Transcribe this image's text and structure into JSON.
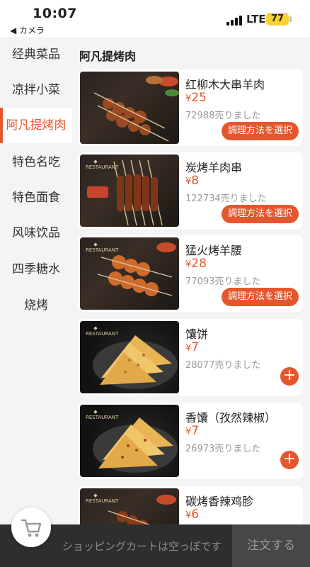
{
  "status_bar": {
    "time": "10:07",
    "back_label": "◀ カメラ",
    "network": "LTE",
    "battery": "77"
  },
  "sidebar": {
    "items": [
      {
        "label": "经典菜品",
        "active": false
      },
      {
        "label": "凉拌小菜",
        "active": false
      },
      {
        "label": "阿凡提烤肉",
        "active": true
      },
      {
        "label": "特色名吃",
        "active": false
      },
      {
        "label": "特色面食",
        "active": false
      },
      {
        "label": "风味饮品",
        "active": false
      },
      {
        "label": "四季糖水",
        "active": false
      },
      {
        "label": "烧烤",
        "active": false
      }
    ]
  },
  "main": {
    "category_title": "阿凡提烤肉",
    "currency": "¥",
    "products": [
      {
        "name": "红柳木大串羊肉",
        "price": "25",
        "sold": "72988売りました",
        "action": "調理方法を選択",
        "image": "skewer"
      },
      {
        "name": "炭烤羊肉串",
        "price": "8",
        "sold": "122734売りました",
        "action": "調理方法を選択",
        "image": "skewer"
      },
      {
        "name": "猛火烤羊腰",
        "price": "28",
        "sold": "77093売りました",
        "action": "調理方法を選択",
        "image": "skewer"
      },
      {
        "name": "馕饼",
        "price": "7",
        "sold": "28077売りました",
        "action": "+",
        "image": "bread"
      },
      {
        "name": "香馕（孜然辣椒）",
        "price": "7",
        "sold": "26973売りました",
        "action": "+",
        "image": "bread"
      },
      {
        "name": "碳烤香辣鸡胗",
        "price": "6",
        "sold": "",
        "action": "",
        "image": "skewer"
      }
    ]
  },
  "cart": {
    "empty_text": "ショッピングカートは空っぽです",
    "order_label": "注文する"
  },
  "colors": {
    "accent": "#e4572e",
    "cart_bar": "#2e2e2e"
  }
}
